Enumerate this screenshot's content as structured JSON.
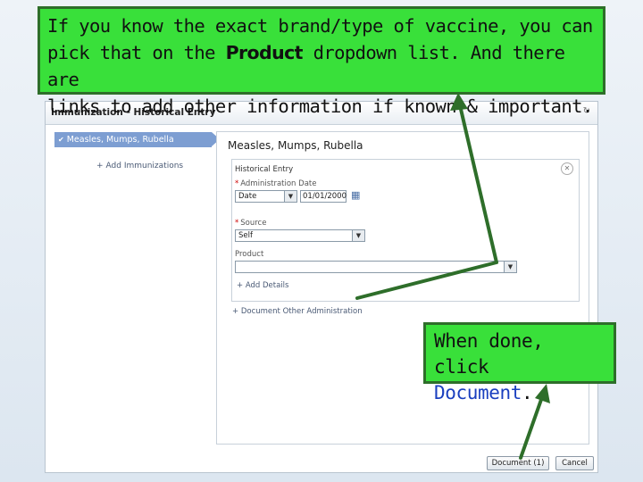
{
  "callouts": {
    "top_line1_a": "If you know the exact brand/type of vaccine, you can",
    "top_line2_a": "pick that on the ",
    "top_line2_b": "Product",
    "top_line2_c": " dropdown list.  And there are",
    "top_line3_a": "links to add other information if known & important.",
    "bottom_line1": "When done, click",
    "bottom_line2": "Document",
    "bottom_line2_end": "."
  },
  "window": {
    "title": "Immunization - Historical Entry",
    "refresh_icon": "refresh-icon"
  },
  "left_pane": {
    "selected_item": "Measles, Mumps, Rubella",
    "add_immunizations": "Add Immunizations"
  },
  "right_pane": {
    "vaccine_title": "Measles, Mumps, Rubella",
    "entry_header": "Historical Entry",
    "admin_date_label": "Administration Date",
    "date_select_value": "Date",
    "date_value": "01/01/2000",
    "source_label": "Source",
    "source_value": "Self",
    "product_label": "Product",
    "product_value": "",
    "add_details": "Add Details",
    "document_other": "Document Other Administration"
  },
  "buttons": {
    "document": "Document (1)",
    "cancel": "Cancel"
  },
  "colors": {
    "callout_fill": "#39e03a",
    "callout_border": "#2e6e2a",
    "arrow": "#2e8a2a",
    "selection": "#7d9ed2"
  }
}
